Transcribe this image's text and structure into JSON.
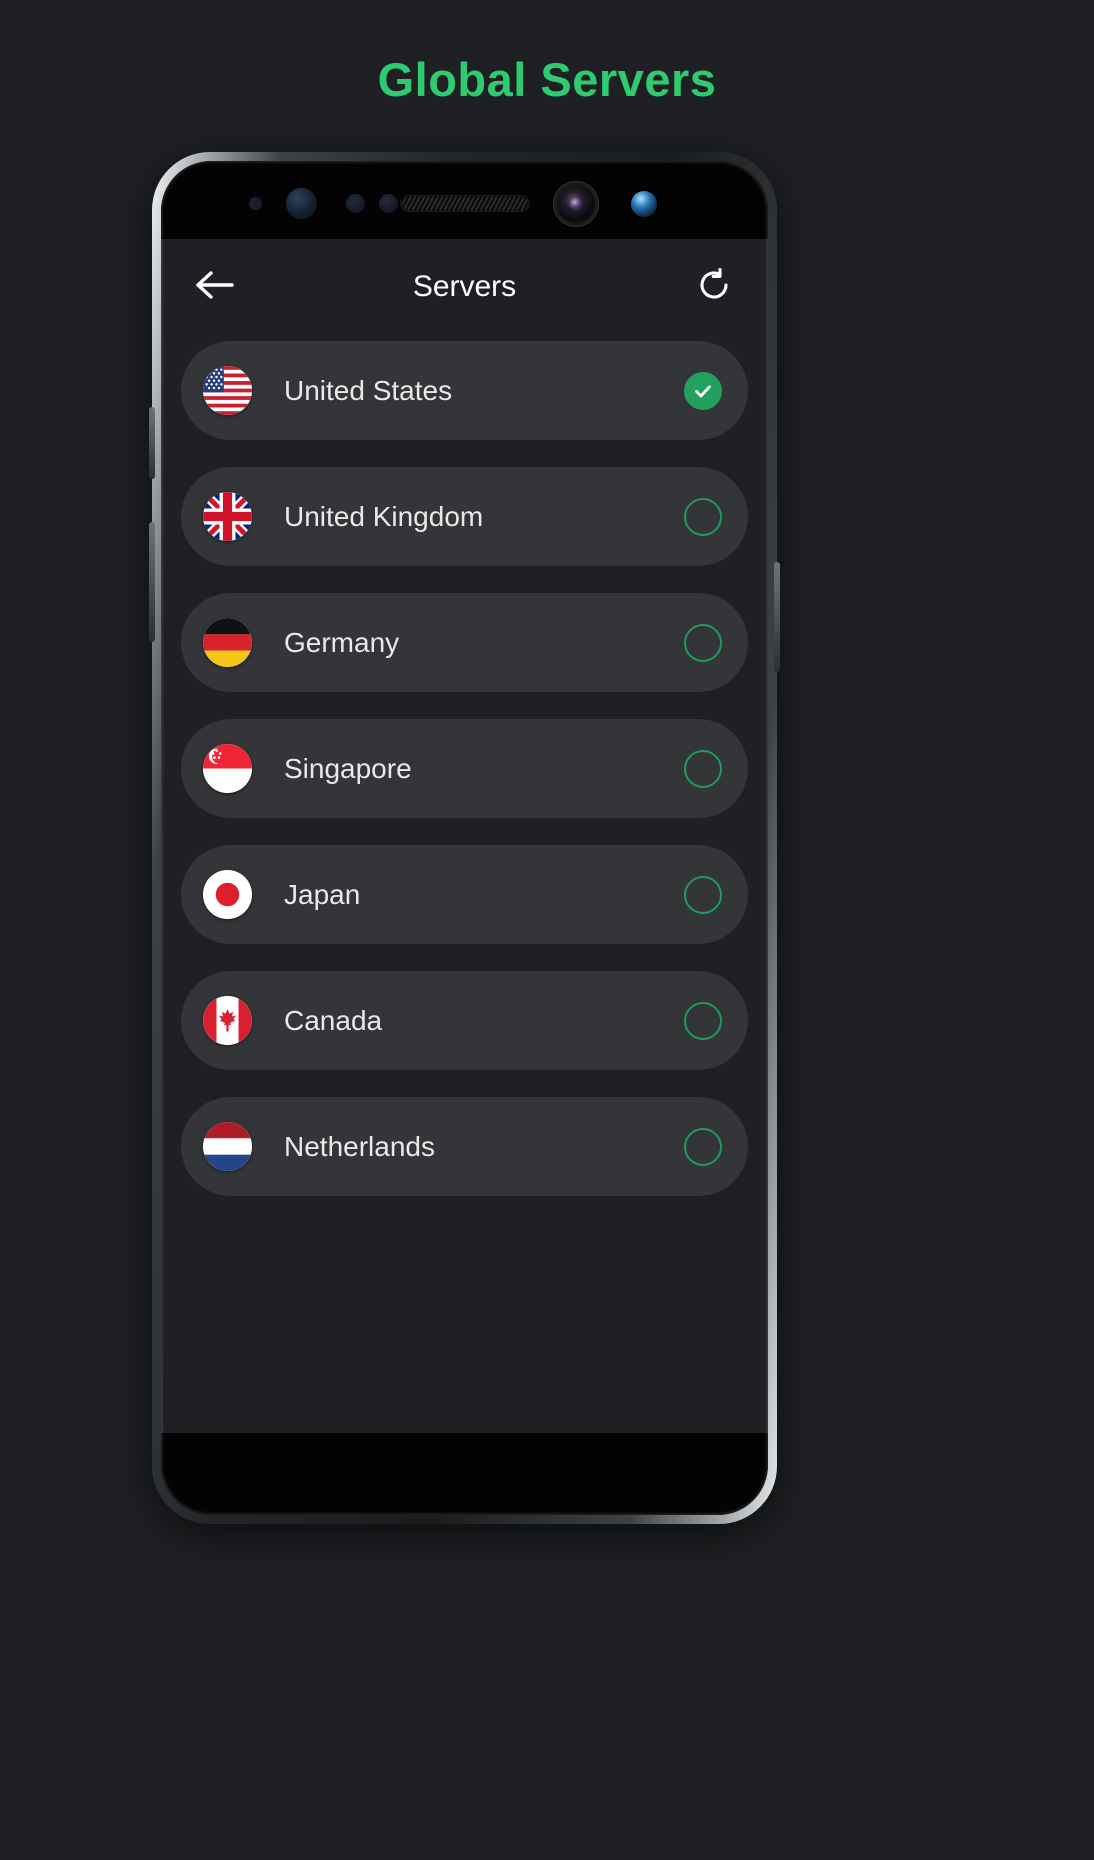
{
  "page": {
    "title": "Global Servers",
    "title_color": "#2ecb71",
    "background_color": "#1e2023"
  },
  "app": {
    "header": {
      "back_icon": "back-arrow-icon",
      "title": "Servers",
      "refresh_icon": "refresh-icon"
    },
    "accent_color": "#21a05e",
    "row_background": "#333538",
    "servers": [
      {
        "name": "United States",
        "flag": "us-flag-icon",
        "selected": true
      },
      {
        "name": "United Kingdom",
        "flag": "uk-flag-icon",
        "selected": false
      },
      {
        "name": "Germany",
        "flag": "de-flag-icon",
        "selected": false
      },
      {
        "name": "Singapore",
        "flag": "sg-flag-icon",
        "selected": false
      },
      {
        "name": "Japan",
        "flag": "jp-flag-icon",
        "selected": false
      },
      {
        "name": "Canada",
        "flag": "ca-flag-icon",
        "selected": false
      },
      {
        "name": "Netherlands",
        "flag": "nl-flag-icon",
        "selected": false
      }
    ]
  }
}
